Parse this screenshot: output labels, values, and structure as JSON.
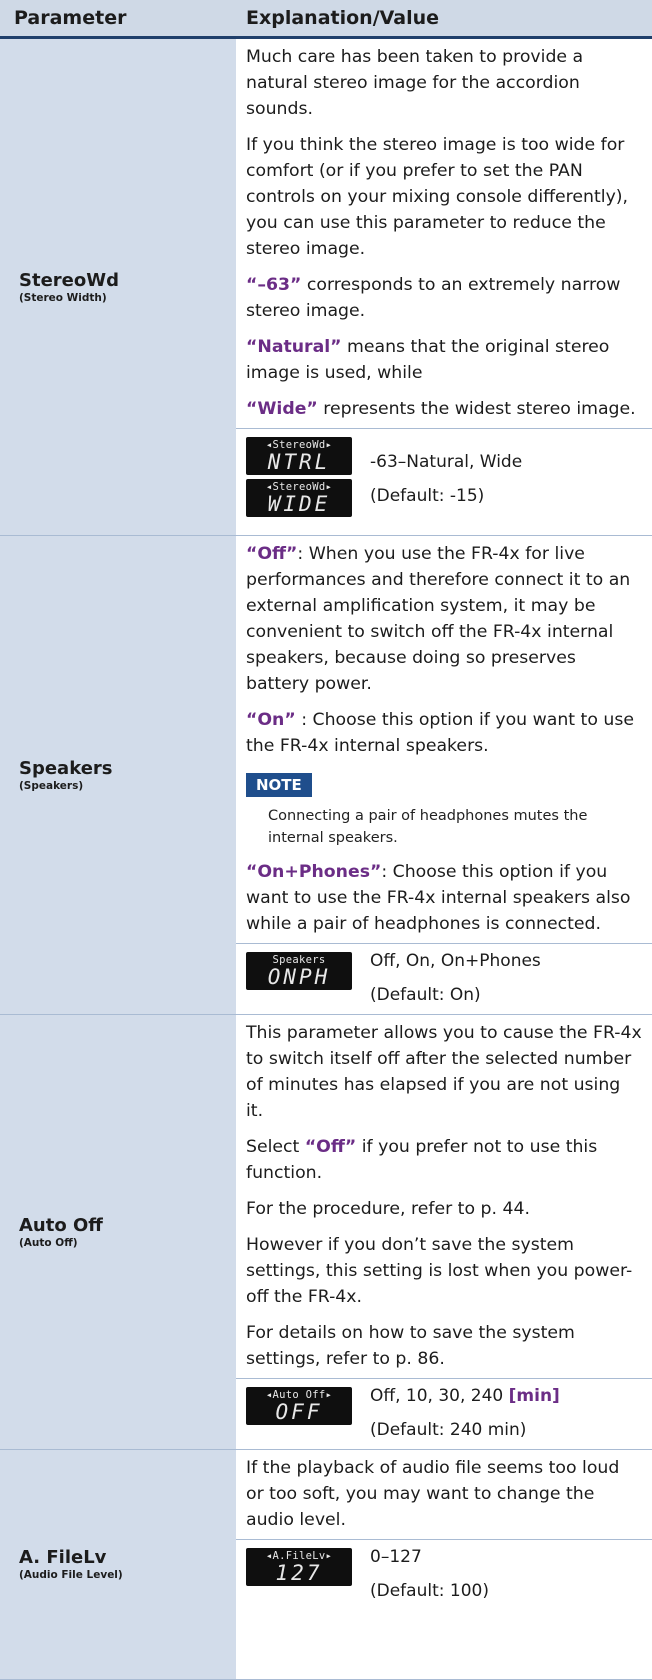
{
  "header": {
    "col1": "Parameter",
    "col2": "Explanation/Value"
  },
  "rows": [
    {
      "name": "StereoWd",
      "sub": "(Stereo Width)",
      "p1": "Much care has been taken to provide a natural stereo image for the accordion sounds.",
      "p2": "If you think the stereo image is too wide for comfort (or if you prefer to set the PAN controls on your mixing console differently), you can use this parameter to reduce the stereo image.",
      "kw3": "“–63”",
      "p3": " corresponds to an extremely narrow stereo image.",
      "kw4": "“Natural”",
      "p4": " means that the original stereo image is used, while",
      "kw5": "“Wide”",
      "p5": " represents the widest stereo image.",
      "lcd1_top": "◂StereoWd▸",
      "lcd1_main": "NTRL",
      "lcd2_top": "◂StereoWd▸",
      "lcd2_main": "WIDE",
      "range": "-63–Natural, Wide",
      "default": "(Default: -15)"
    },
    {
      "name": "Speakers",
      "sub": "(Speakers)",
      "kw1": "“Off”",
      "p1": ": When you use the FR-4x for live performances and therefore connect it to an external amplification system, it may be convenient to switch off the FR-4x internal speakers, because doing so preserves battery power.",
      "kw2": "“On”",
      "p2": " : Choose this option if you want to use the FR-4x internal speakers.",
      "note_label": "NOTE",
      "note_text": "Connecting a pair of headphones mutes the internal speakers.",
      "kw3": "“On+Phones”",
      "p3": ": Choose this option if you want to use the FR-4x internal speakers also while a pair of headphones is connected.",
      "lcd_top": "Speakers",
      "lcd_main": "ONPH",
      "range": "Off, On, On+Phones",
      "default": "(Default: On)"
    },
    {
      "name": "Auto Off",
      "sub": "(Auto Off)",
      "p1": "This parameter allows you to cause the FR-4x to switch itself off after the selected number of minutes has elapsed if you are not using it.",
      "p2a": "Select ",
      "kw2": "“Off”",
      "p2b": " if you prefer not to use this function.",
      "p3": "For the procedure, refer to p. 44.",
      "p4": "However if you don’t save the system settings, this setting is lost when you power-off the FR-4x.",
      "p5": "For details on how to save the system settings, refer to p. 86.",
      "lcd_top": "◂Auto Off▸",
      "lcd_main": "OFF",
      "range": "Off, 10, 30, 240 ",
      "unit": "[min]",
      "default": "(Default: 240 min)"
    },
    {
      "name": "A. FileLv",
      "sub": "(Audio File Level)",
      "p1": "If the playback of audio file seems too loud or too soft, you may want to change the audio level.",
      "lcd_top": "◂A.FileLv▸",
      "lcd_main": "127",
      "range": "0–127",
      "default": "(Default: 100)"
    }
  ]
}
